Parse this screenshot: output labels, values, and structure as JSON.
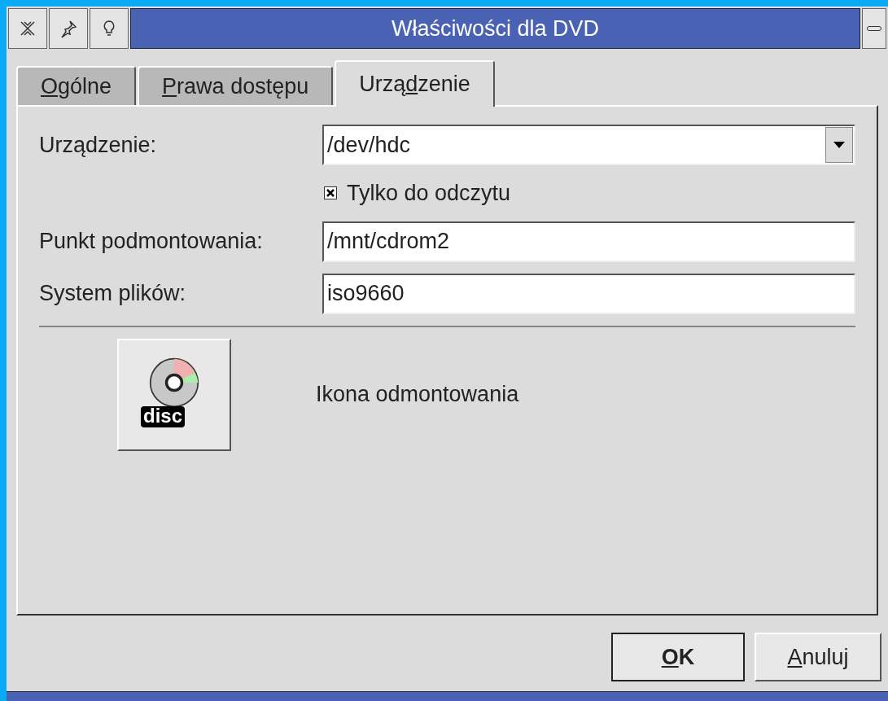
{
  "window": {
    "title": "Właściwości dla DVD"
  },
  "tabs": [
    {
      "key": "O",
      "post": "gólne",
      "selected": false
    },
    {
      "key": "P",
      "post": "rawa dostępu",
      "selected": false
    },
    {
      "pre": "Urzą",
      "key": "d",
      "post": "zenie",
      "selected": true
    }
  ],
  "device": {
    "label": "Urządzenie:",
    "value": "/dev/hdc"
  },
  "read_only": {
    "label": "Tylko do odczytu",
    "checked": true
  },
  "mount_point": {
    "label": "Punkt podmontowania:",
    "value": "/mnt/cdrom2"
  },
  "filesystem": {
    "label": "System plików:",
    "value": "iso9660"
  },
  "unmount_icon": {
    "icon_text": "disc",
    "label": "Ikona odmontowania"
  },
  "buttons": [
    {
      "key": "O",
      "post": "K",
      "default": true
    },
    {
      "key": "A",
      "post": "nuluj",
      "default": false
    }
  ]
}
